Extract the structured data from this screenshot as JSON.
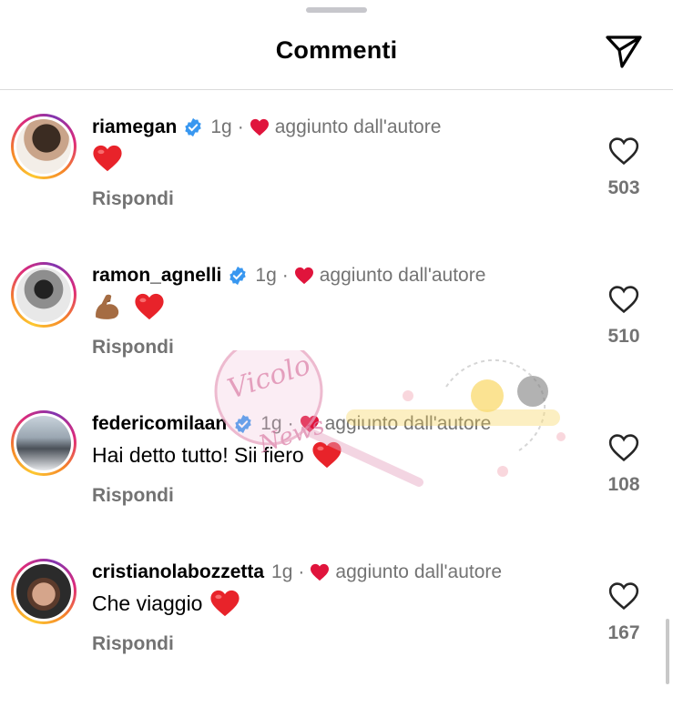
{
  "header": {
    "title": "Commenti",
    "share_icon": "paper-plane-icon"
  },
  "colors": {
    "verified": "#3897f0",
    "heart": "#e0143c",
    "secondary_text": "#737373",
    "divider": "#dbdbdb"
  },
  "comments": [
    {
      "username": "riamegan",
      "verified": true,
      "time": "1g",
      "separator": "·",
      "author_like": "aggiunto dall'autore",
      "text": "",
      "emojis": [
        "red-heart"
      ],
      "reply": "Rispondi",
      "likes": "503"
    },
    {
      "username": "ramon_agnelli",
      "verified": true,
      "time": "1g",
      "separator": "·",
      "author_like": "aggiunto dall'autore",
      "text": "",
      "emojis": [
        "flexed-biceps",
        "red-heart"
      ],
      "reply": "Rispondi",
      "likes": "510"
    },
    {
      "username": "federicomilaan",
      "verified": true,
      "time": "1g",
      "separator": "·",
      "author_like": "aggiunto dall'autore",
      "text": "Hai detto tutto! Sii fiero",
      "emojis": [
        "red-heart"
      ],
      "reply": "Rispondi",
      "likes": "108"
    },
    {
      "username": "cristianolabozzetta",
      "verified": false,
      "time": "1g",
      "separator": "·",
      "author_like": "aggiunto dall'autore",
      "text": "Che viaggio",
      "emojis": [
        "red-heart"
      ],
      "reply": "Rispondi",
      "likes": "167"
    }
  ],
  "watermark": {
    "text": "Vicolo delle News",
    "description": "semi-transparent magnifying glass logo watermark"
  }
}
